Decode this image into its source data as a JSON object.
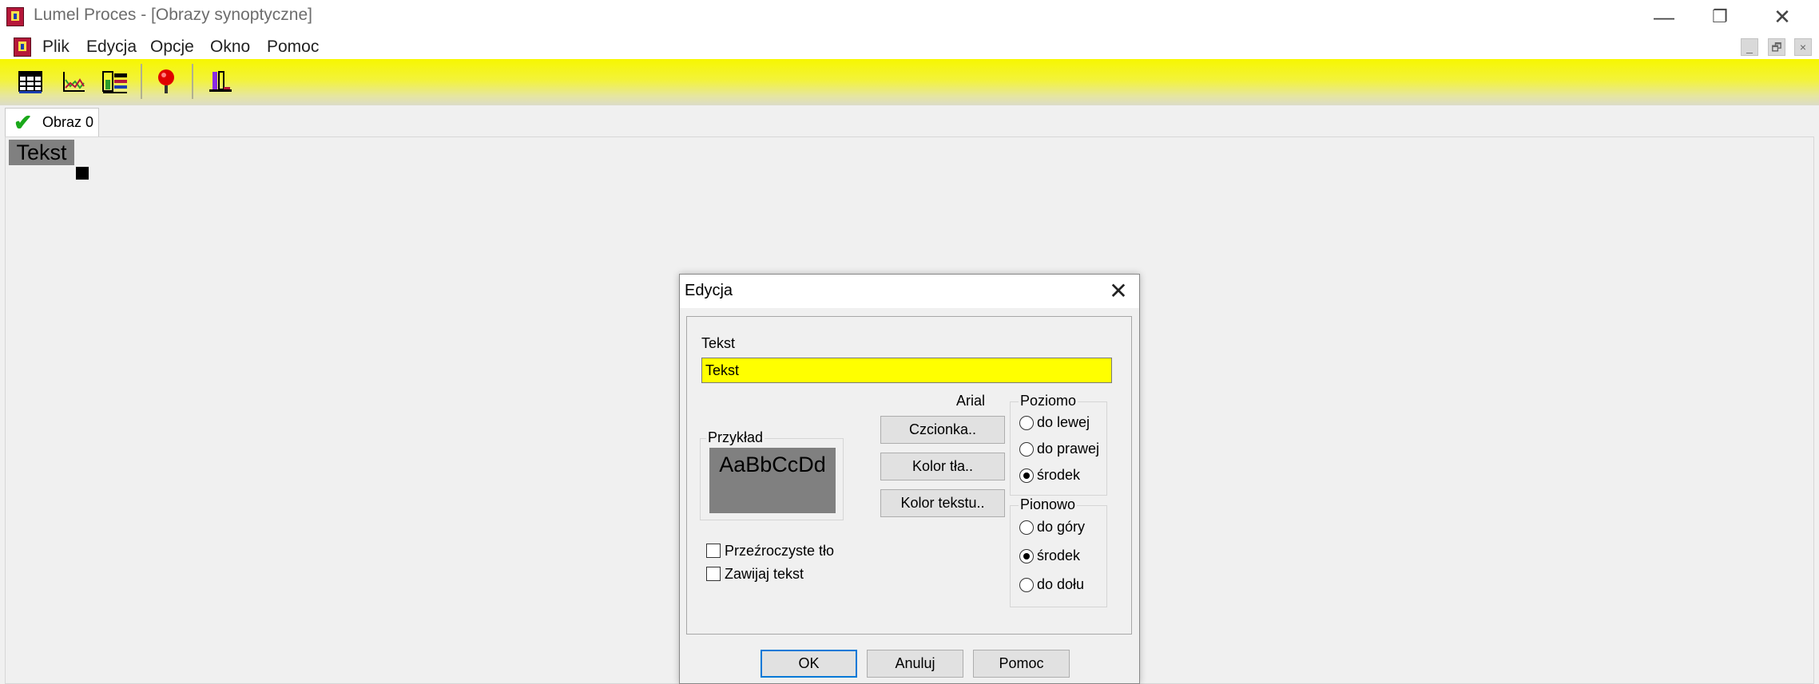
{
  "window": {
    "title": "Lumel Proces - [Obrazy synoptyczne]",
    "controls": {
      "minimize": "—",
      "restore": "❐",
      "close": "✕"
    }
  },
  "menu": {
    "items": [
      "Plik",
      "Edycja",
      "Opcje",
      "Okno",
      "Pomoc"
    ],
    "mdi_controls": [
      "_",
      "🗗",
      "×"
    ]
  },
  "toolbar": {
    "buttons": [
      "table-icon",
      "line-chart-icon",
      "bar-list-icon",
      "red-pin-icon",
      "chart-settings-icon"
    ],
    "accent_color": "#f7f700"
  },
  "tabs": [
    {
      "label": "Obraz 0",
      "icon": "checkmark-icon"
    }
  ],
  "canvas": {
    "text_object": "Tekst"
  },
  "dialog": {
    "title": "Edycja",
    "text_label": "Tekst",
    "text_value": "Tekst",
    "font_name": "Arial",
    "sample_group": "Przykład",
    "sample_text": "AaBbCcDd",
    "buttons": {
      "font": "Czcionka..",
      "bg_color": "Kolor tła..",
      "text_color": "Kolor tekstu.."
    },
    "horizontal": {
      "title": "Poziomo",
      "options": [
        "do lewej",
        "do prawej",
        "środek"
      ],
      "selected": "środek"
    },
    "vertical": {
      "title": "Pionowo",
      "options": [
        "do góry",
        "środek",
        "do dołu"
      ],
      "selected": "środek"
    },
    "checkboxes": {
      "transparent_bg": {
        "label": "Przeźroczyste tło",
        "checked": false
      },
      "wrap_text": {
        "label": "Zawijaj tekst",
        "checked": false
      }
    },
    "footer": {
      "ok": "OK",
      "cancel": "Anuluj",
      "help": "Pomoc"
    }
  }
}
